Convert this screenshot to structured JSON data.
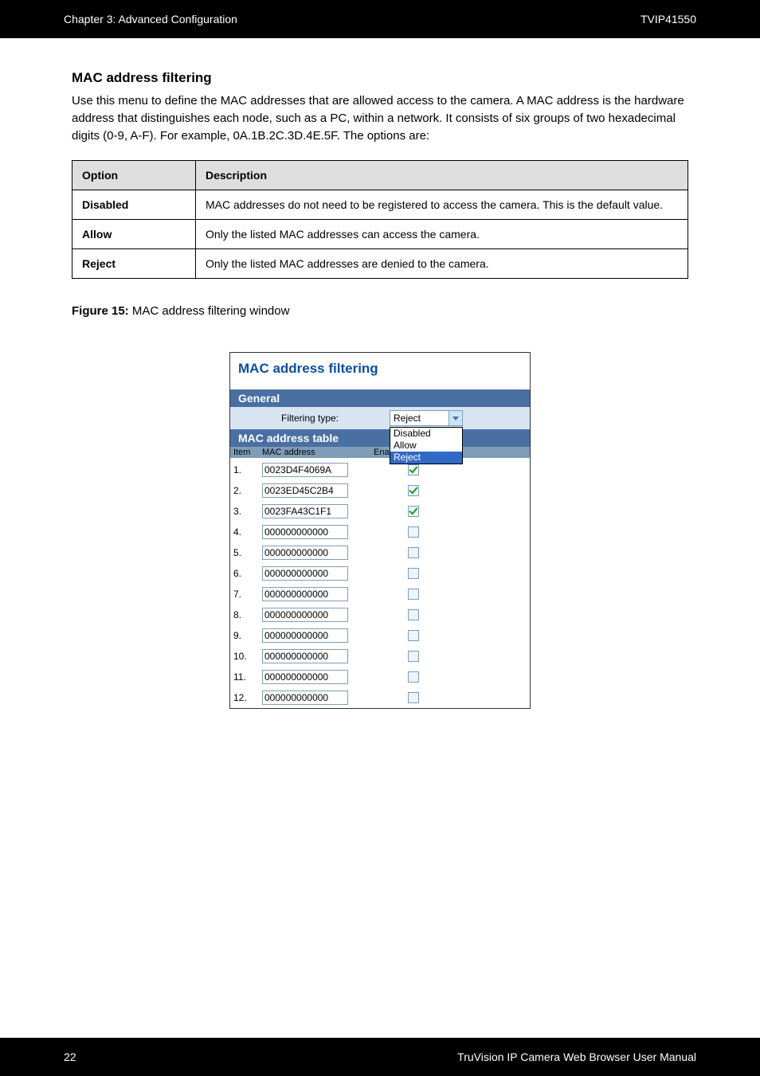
{
  "header": {
    "left": "Chapter 3: Advanced Configuration",
    "right": "TVIP41550"
  },
  "footer": {
    "left": "22",
    "right": "TruVision IP Camera Web Browser User Manual"
  },
  "section": {
    "title": "MAC address filtering",
    "intro": "Use this menu to define the MAC addresses that are allowed access to the camera. A MAC address is the hardware address that distinguishes each node, such as a PC, within a network. It consists of six groups of two hexadecimal digits (0-9, A-F). For example, 0A.1B.2C.3D.4E.5F. The options are:"
  },
  "options_table": {
    "headers": [
      "Option",
      "Description"
    ],
    "rows": [
      {
        "opt": "Disabled",
        "desc": "MAC addresses do not need to be registered to access the camera. This is the default value."
      },
      {
        "opt": "Allow",
        "desc": "Only the listed MAC addresses can access the camera."
      },
      {
        "opt": "Reject",
        "desc": "Only the listed MAC addresses are denied to the camera."
      }
    ]
  },
  "figure_caption_prefix": "Figure 15:",
  "figure_caption": "MAC address filtering window",
  "mac_panel": {
    "title": "MAC address filtering",
    "general_label": "General",
    "filter_type_label": "Filtering type:",
    "filter_selected": "Reject",
    "filter_options": [
      "Disabled",
      "Allow",
      "Reject"
    ],
    "table_label": "MAC address table",
    "col_item": "Item",
    "col_mac": "MAC address",
    "col_enable": "Enable",
    "rows": [
      {
        "idx": "1.",
        "mac": "0023D4F4069A",
        "checked": true
      },
      {
        "idx": "2.",
        "mac": "0023ED45C2B4",
        "checked": true
      },
      {
        "idx": "3.",
        "mac": "0023FA43C1F1",
        "checked": true
      },
      {
        "idx": "4.",
        "mac": "000000000000",
        "checked": false
      },
      {
        "idx": "5.",
        "mac": "000000000000",
        "checked": false
      },
      {
        "idx": "6.",
        "mac": "000000000000",
        "checked": false
      },
      {
        "idx": "7.",
        "mac": "000000000000",
        "checked": false
      },
      {
        "idx": "8.",
        "mac": "000000000000",
        "checked": false
      },
      {
        "idx": "9.",
        "mac": "000000000000",
        "checked": false
      },
      {
        "idx": "10.",
        "mac": "000000000000",
        "checked": false
      },
      {
        "idx": "11.",
        "mac": "000000000000",
        "checked": false
      },
      {
        "idx": "12.",
        "mac": "000000000000",
        "checked": false
      }
    ]
  }
}
